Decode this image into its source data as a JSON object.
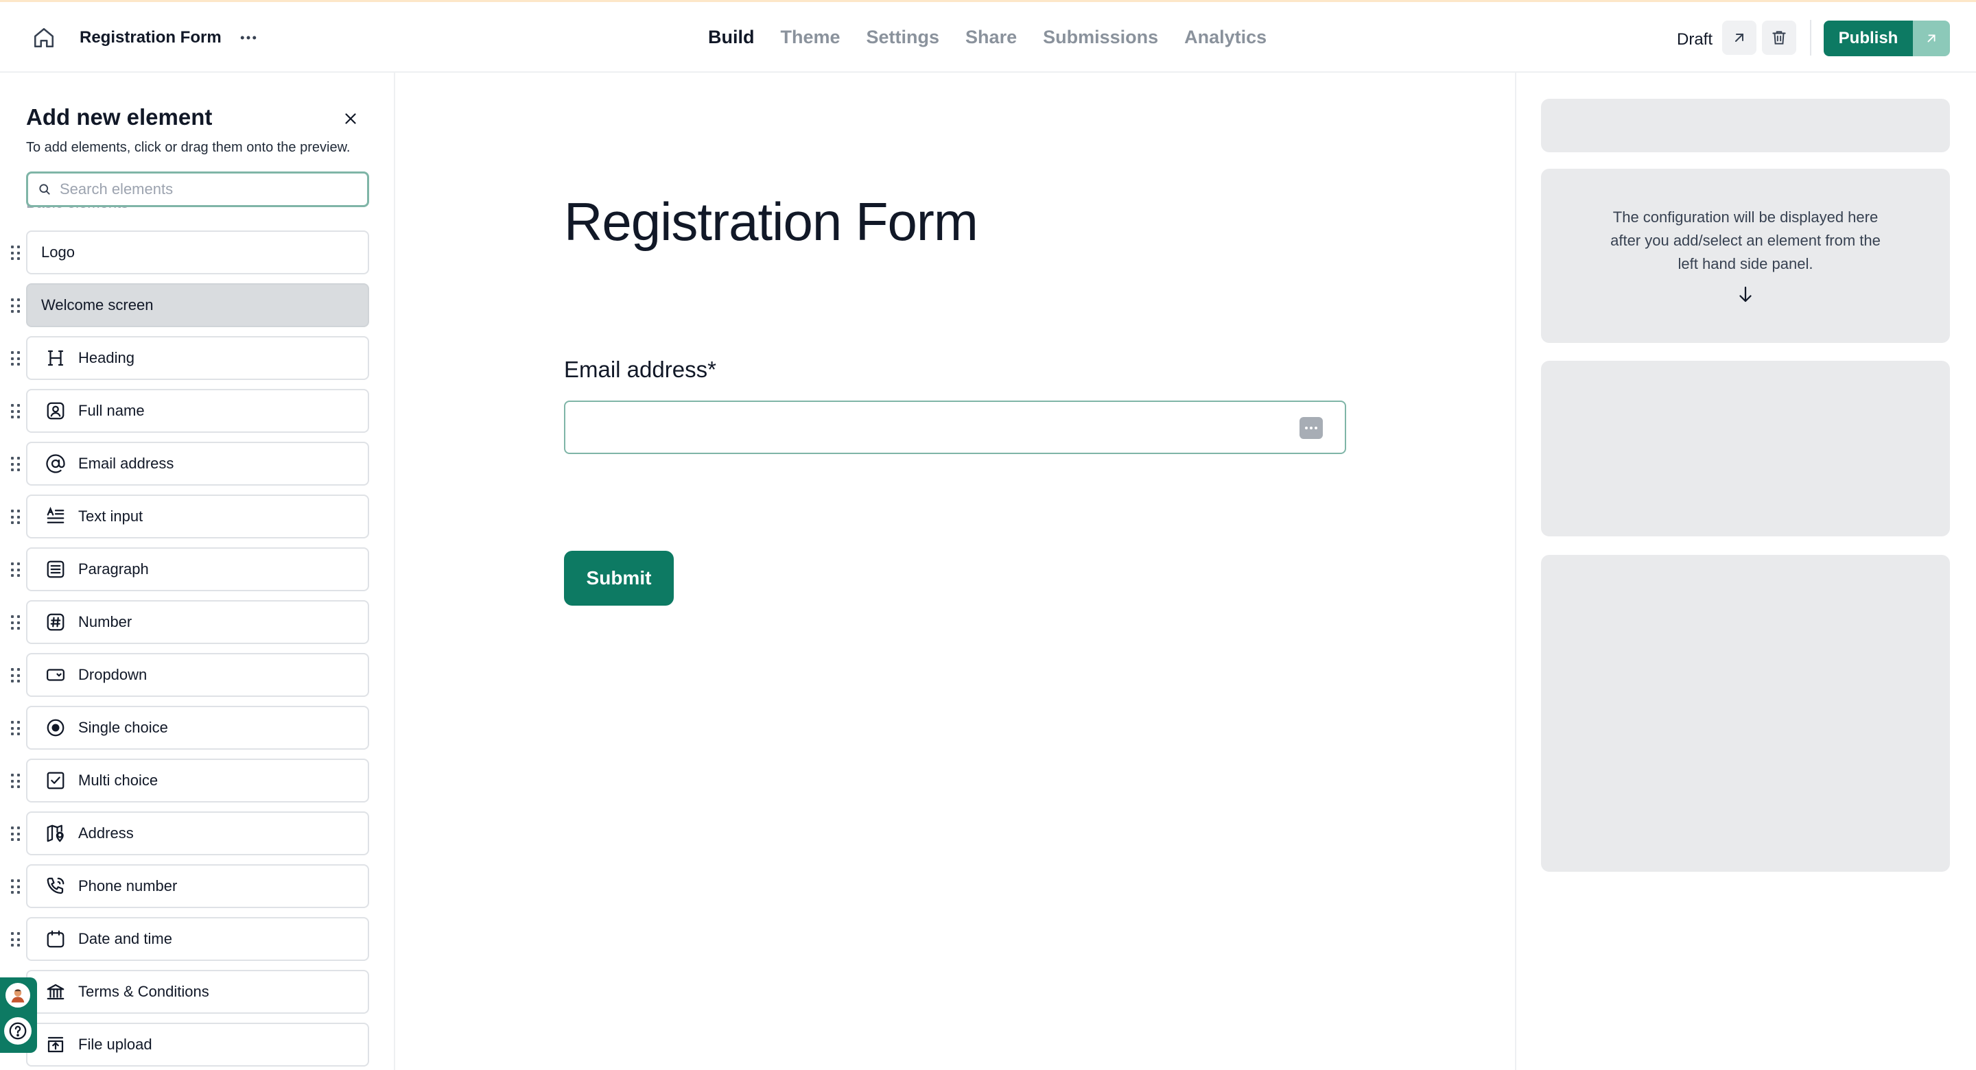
{
  "header": {
    "form_title": "Registration Form",
    "tabs": [
      {
        "label": "Build",
        "active": true
      },
      {
        "label": "Theme",
        "active": false
      },
      {
        "label": "Settings",
        "active": false
      },
      {
        "label": "Share",
        "active": false
      },
      {
        "label": "Submissions",
        "active": false
      },
      {
        "label": "Analytics",
        "active": false
      }
    ],
    "status": "Draft",
    "publish_label": "Publish"
  },
  "sidebar": {
    "title": "Add new element",
    "subtitle": "To add elements, click or drag them onto the preview.",
    "search_placeholder": "Search elements",
    "section_peek": "Basic elements",
    "items": [
      {
        "label": "Logo",
        "icon": "none"
      },
      {
        "label": "Welcome screen",
        "icon": "none",
        "selected": true
      },
      {
        "label": "Heading",
        "icon": "heading-icon"
      },
      {
        "label": "Full name",
        "icon": "user-icon"
      },
      {
        "label": "Email address",
        "icon": "at-sign-icon"
      },
      {
        "label": "Text input",
        "icon": "text-input-icon"
      },
      {
        "label": "Paragraph",
        "icon": "paragraph-icon"
      },
      {
        "label": "Number",
        "icon": "hash-icon"
      },
      {
        "label": "Dropdown",
        "icon": "dropdown-icon"
      },
      {
        "label": "Single choice",
        "icon": "radio-icon"
      },
      {
        "label": "Multi choice",
        "icon": "checkbox-icon"
      },
      {
        "label": "Address",
        "icon": "map-icon"
      },
      {
        "label": "Phone number",
        "icon": "phone-icon"
      },
      {
        "label": "Date and time",
        "icon": "calendar-icon"
      },
      {
        "label": "Terms & Conditions",
        "icon": "bank-icon"
      },
      {
        "label": "File upload",
        "icon": "upload-icon"
      }
    ]
  },
  "preview": {
    "title": "Registration Form",
    "field_label": "Email address*",
    "field_value": "",
    "submit_label": "Submit"
  },
  "config_panel": {
    "message": "The configuration will be displayed here after you add/select an element from the left hand side panel."
  },
  "colors": {
    "primary": "#0d7a63",
    "primary_light": "#8cc9b9",
    "skeleton": "#e9eaec"
  }
}
